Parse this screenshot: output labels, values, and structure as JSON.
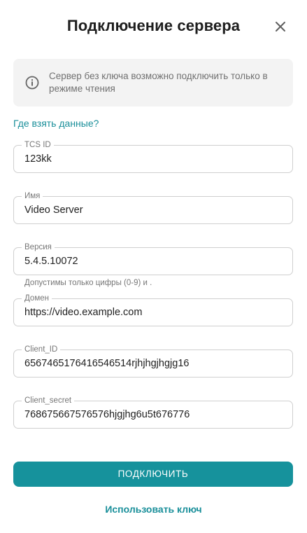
{
  "dialog": {
    "title": "Подключение сервера",
    "close_icon": "close-icon"
  },
  "info": {
    "icon": "info-icon",
    "text": "Сервер без ключа возможно подключить только в режиме чтения"
  },
  "help_link": "Где взять данные?",
  "fields": {
    "tcs_id": {
      "label": "TCS ID",
      "value": "123kk"
    },
    "name": {
      "label": "Имя",
      "value": "Video Server"
    },
    "version": {
      "label": "Версия",
      "value": "5.4.5.10072",
      "hint": "Допустимы только цифры (0-9) и ."
    },
    "domain": {
      "label": "Домен",
      "value": "https://video.example.com"
    },
    "client_id": {
      "label": "Client_ID",
      "value": "6567465176416546514rjhjhgjhgjg16"
    },
    "client_secret": {
      "label": "Client_secret",
      "value": "768675667576576hjgjhg6u5t676776"
    }
  },
  "actions": {
    "connect": "ПОДКЛЮЧИТЬ",
    "use_key": "Использовать ключ"
  },
  "colors": {
    "accent": "#16929c",
    "link": "#1a8f9a",
    "info_bg": "#f3f3f3",
    "border": "#cfcfcf"
  }
}
